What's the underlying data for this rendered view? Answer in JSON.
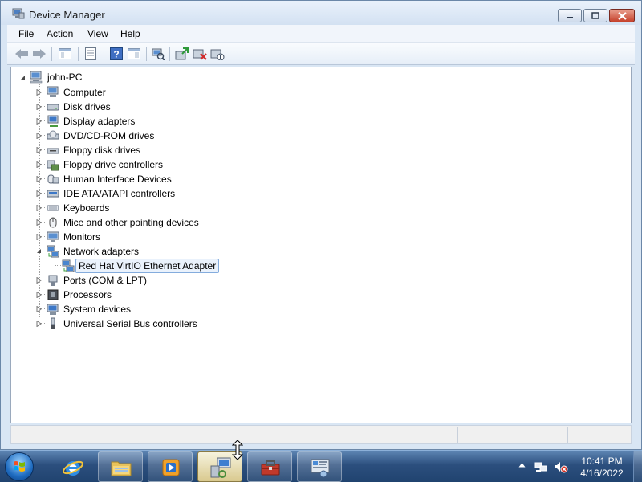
{
  "window": {
    "title": "Device Manager",
    "menu": [
      "File",
      "Action",
      "View",
      "Help"
    ]
  },
  "toolbar": {
    "buttons": [
      "back-icon",
      "forward-icon",
      "show-hide-tree-icon",
      "properties-icon",
      "help-icon",
      "action-pane-icon",
      "scan-hardware-icon",
      "update-driver-icon",
      "uninstall-icon",
      "disable-device-icon"
    ]
  },
  "tree": {
    "root": "john-PC",
    "categories": [
      {
        "label": "Computer",
        "icon": "computer-icon",
        "expanded": false
      },
      {
        "label": "Disk drives",
        "icon": "disk-drive-icon",
        "expanded": false
      },
      {
        "label": "Display adapters",
        "icon": "display-adapter-icon",
        "expanded": false
      },
      {
        "label": "DVD/CD-ROM drives",
        "icon": "dvd-drive-icon",
        "expanded": false
      },
      {
        "label": "Floppy disk drives",
        "icon": "floppy-drive-icon",
        "expanded": false
      },
      {
        "label": "Floppy drive controllers",
        "icon": "floppy-controller-icon",
        "expanded": false
      },
      {
        "label": "Human Interface Devices",
        "icon": "hid-icon",
        "expanded": false
      },
      {
        "label": "IDE ATA/ATAPI controllers",
        "icon": "ide-controller-icon",
        "expanded": false
      },
      {
        "label": "Keyboards",
        "icon": "keyboard-icon",
        "expanded": false
      },
      {
        "label": "Mice and other pointing devices",
        "icon": "mouse-icon",
        "expanded": false
      },
      {
        "label": "Monitors",
        "icon": "monitor-icon",
        "expanded": false
      },
      {
        "label": "Network adapters",
        "icon": "network-adapter-icon",
        "expanded": true
      },
      {
        "label": "Ports (COM & LPT)",
        "icon": "port-icon",
        "expanded": false
      },
      {
        "label": "Processors",
        "icon": "processor-icon",
        "expanded": false
      },
      {
        "label": "System devices",
        "icon": "system-device-icon",
        "expanded": false
      },
      {
        "label": "Universal Serial Bus controllers",
        "icon": "usb-icon",
        "expanded": false
      }
    ],
    "child": {
      "parent": "Network adapters",
      "label": "Red Hat VirtIO Ethernet Adapter",
      "icon": "network-adapter-icon",
      "selected": true
    }
  },
  "taskbar": {
    "pinned": [
      "internet-explorer-icon",
      "windows-explorer-icon",
      "media-player-icon",
      "device-manager-icon",
      "toolbox-icon",
      "control-panel-icon"
    ],
    "active": "device-manager-icon",
    "tray": [
      "show-hidden-icons-icon",
      "network-icon",
      "volume-muted-icon"
    ],
    "clock_time": "10:41 PM",
    "clock_date": "4/16/2022"
  },
  "colors": {
    "selection_border": "#84acdd",
    "selection_fill": "#eaf2fc",
    "window_frame": "#d9e6f4",
    "taskbar": "#2c4f7e"
  }
}
